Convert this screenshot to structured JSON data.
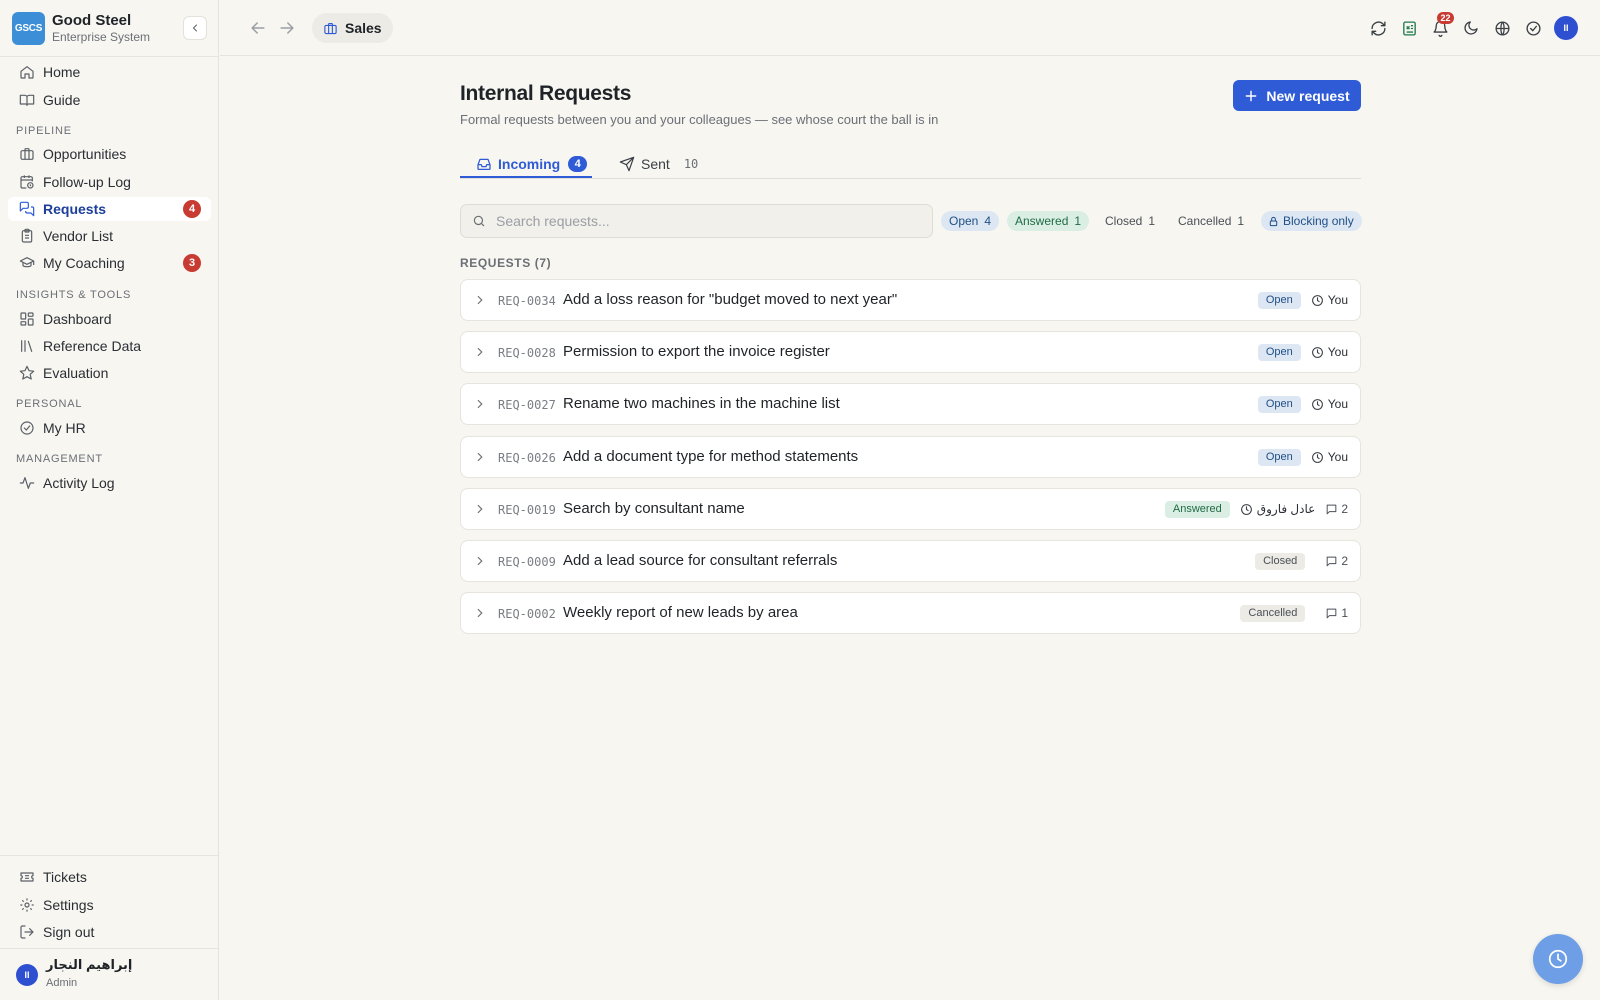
{
  "brand": {
    "logo_text": "GSCS",
    "name": "Good Steel",
    "subtitle": "Enterprise System"
  },
  "sidebar": {
    "top_items": [
      {
        "label": "Home",
        "icon": "home-icon"
      },
      {
        "label": "Guide",
        "icon": "book-icon"
      }
    ],
    "sections": [
      {
        "label": "PIPELINE",
        "items": [
          {
            "label": "Opportunities",
            "icon": "briefcase-icon"
          },
          {
            "label": "Follow-up Log",
            "icon": "calendar-clock-icon"
          },
          {
            "label": "Requests",
            "icon": "requests-icon",
            "badge": "4",
            "active": true
          },
          {
            "label": "Vendor List",
            "icon": "clipboard-icon"
          },
          {
            "label": "My Coaching",
            "icon": "graduation-cap-icon",
            "badge": "3"
          }
        ]
      },
      {
        "label": "INSIGHTS & TOOLS",
        "items": [
          {
            "label": "Dashboard",
            "icon": "dashboard-icon"
          },
          {
            "label": "Reference Data",
            "icon": "library-icon"
          },
          {
            "label": "Evaluation",
            "icon": "star-icon"
          }
        ]
      },
      {
        "label": "PERSONAL",
        "items": [
          {
            "label": "My HR",
            "icon": "check-circle-icon"
          }
        ]
      },
      {
        "label": "MANAGEMENT",
        "items": [
          {
            "label": "Activity Log",
            "icon": "activity-icon"
          }
        ]
      }
    ],
    "bottom_items": [
      {
        "label": "Tickets",
        "icon": "ticket-icon"
      },
      {
        "label": "Settings",
        "icon": "gear-icon"
      },
      {
        "label": "Sign out",
        "icon": "sign-out-icon"
      }
    ],
    "user": {
      "initials": "II",
      "name": "إبراهيم النجار",
      "role": "Admin"
    }
  },
  "topbar": {
    "breadcrumb": "Sales",
    "notification_count": "22",
    "avatar_initials": "II"
  },
  "main": {
    "title": "Internal Requests",
    "subtitle": "Formal requests between you and your colleagues — see whose court the ball is in",
    "new_button": "New request",
    "tabs": {
      "incoming": {
        "label": "Incoming",
        "count": "4"
      },
      "sent": {
        "label": "Sent",
        "count": "10"
      }
    },
    "search_placeholder": "Search requests...",
    "filters": {
      "open": {
        "label": "Open",
        "count": "4"
      },
      "answered": {
        "label": "Answered",
        "count": "1"
      },
      "closed": {
        "label": "Closed",
        "count": "1"
      },
      "cancelled": {
        "label": "Cancelled",
        "count": "1"
      },
      "blocking": {
        "label": "Blocking only"
      }
    },
    "list_label": "REQUESTS (7)",
    "requests": [
      {
        "id": "REQ-0034",
        "title": "Add a loss reason for \"budget moved to next year\"",
        "status": "Open",
        "status_class": "open",
        "owner": "You",
        "comments": ""
      },
      {
        "id": "REQ-0028",
        "title": "Permission to export the invoice register",
        "status": "Open",
        "status_class": "open",
        "owner": "You",
        "comments": ""
      },
      {
        "id": "REQ-0027",
        "title": "Rename two machines in the machine list",
        "status": "Open",
        "status_class": "open",
        "owner": "You",
        "comments": ""
      },
      {
        "id": "REQ-0026",
        "title": "Add a document type for method statements",
        "status": "Open",
        "status_class": "open",
        "owner": "You",
        "comments": ""
      },
      {
        "id": "REQ-0019",
        "title": "Search by consultant name",
        "status": "Answered",
        "status_class": "answered",
        "owner": "عادل فاروق",
        "comments": "2"
      },
      {
        "id": "REQ-0009",
        "title": "Add a lead source for consultant referrals",
        "status": "Closed",
        "status_class": "closed",
        "owner": "",
        "comments": "2"
      },
      {
        "id": "REQ-0002",
        "title": "Weekly report of new leads by area",
        "status": "Cancelled",
        "status_class": "cancelled",
        "owner": "",
        "comments": "1"
      }
    ]
  },
  "colors": {
    "accent": "#2f5bd6",
    "badge_red": "#c83b32",
    "open_bg": "#dde7f3",
    "answered_bg": "#dbeee3"
  }
}
